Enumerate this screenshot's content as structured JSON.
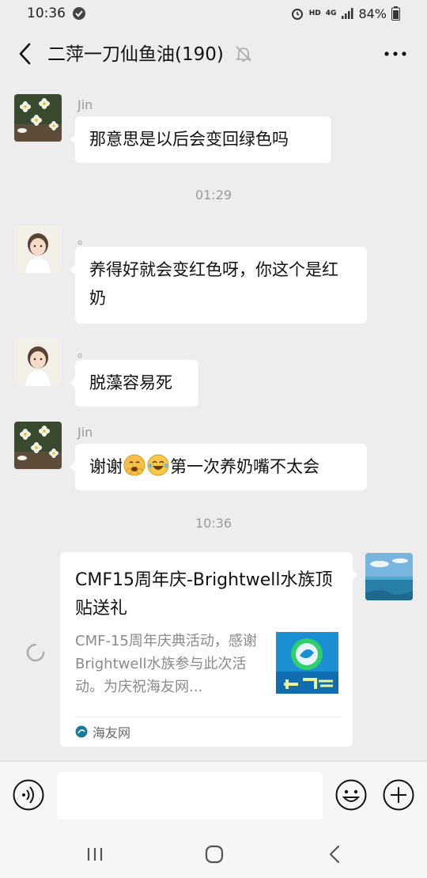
{
  "status": {
    "time": "10:36",
    "hd": "HD",
    "network": "4G",
    "battery": "84%"
  },
  "header": {
    "title": "二萍一刀仙鱼油(190)"
  },
  "messages": [
    {
      "sender": "Jin",
      "text": "那意思是以后会变回绿色吗"
    },
    {
      "time": "01:29"
    },
    {
      "sender": "。",
      "text": "养得好就会变红色呀，你这个是红奶"
    },
    {
      "sender": "。",
      "text": "脱藻容易死"
    },
    {
      "sender": "Jin",
      "text_before": "谢谢",
      "text_after": "第一次养奶嘴不太会",
      "emojis": [
        "hug-emoji",
        "tears-of-joy-emoji"
      ]
    },
    {
      "time": "10:36"
    }
  ],
  "link_card": {
    "title": "CMF15周年庆-Brightwell水族顶贴送礼",
    "description": "CMF-15周年庆典活动，感谢Brightwell水族参与此次活动。为庆祝海友网...",
    "source": "海友网"
  },
  "input": {
    "placeholder": ""
  },
  "colors": {
    "background": "#ededed",
    "bubble": "#ffffff",
    "meta_text": "#9a9a9a"
  },
  "icons": [
    "back-arrow-icon",
    "mute-bell-icon",
    "more-icon",
    "voice-icon",
    "emoji-icon",
    "plus-icon",
    "loading-spinner-icon"
  ]
}
